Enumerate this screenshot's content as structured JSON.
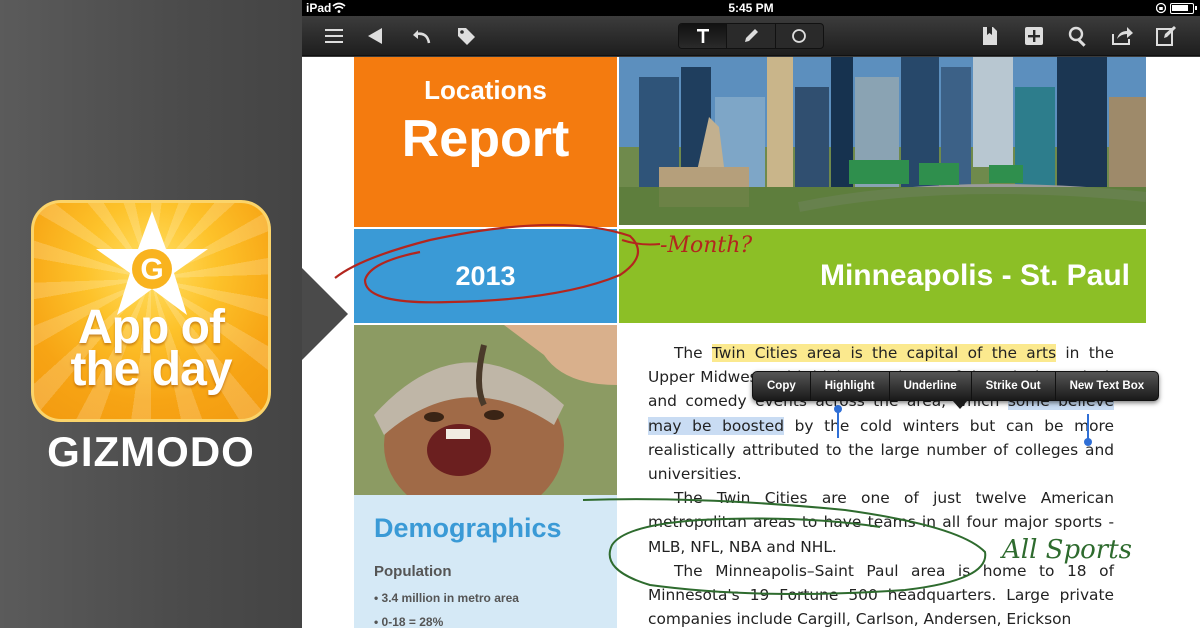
{
  "promo": {
    "badge_letter": "G",
    "badge_title_line1": "App of",
    "badge_title_line2": "the day",
    "brand": "GIZMODO"
  },
  "statusbar": {
    "carrier": "iPad",
    "time": "5:45 PM"
  },
  "toolbar": {
    "left_icons": [
      "menu-icon",
      "back-arrow-icon",
      "undo-icon",
      "tag-icon"
    ],
    "modes": [
      "text-tool-icon",
      "pen-tool-icon",
      "shape-tool-icon"
    ],
    "active_mode": "text-tool-icon",
    "right_icons": [
      "bookmark-icon",
      "add-page-icon",
      "search-icon",
      "share-icon",
      "compose-icon"
    ]
  },
  "document": {
    "title_small": "Locations",
    "title_big": "Report",
    "year": "2013",
    "city": "Minneapolis - St. Paul",
    "demographics_title": "Demographics",
    "population_label": "Population",
    "population_items": [
      "• 3.4 million in metro area",
      "• 0-18 = 28%"
    ],
    "para1_pre": "The ",
    "para1_highlight": "Twin Cities area is the capital of the arts",
    "para1_mid": " in the Upper Midwest, with high attendance of theatrical, musical, and comedy events across the area, which ",
    "para1_selected": "some believe may be boosted",
    "para1_post": " by the cold winters but can be more realistically attributed to the large number of colleges and universities.",
    "para2": "The Twin Cities are one of just twelve American metropolitan areas to have teams in all four major sports - MLB, NFL, NBA and NHL.",
    "para3": "The Minneapolis–Saint Paul area is home to 18 of Minnesota's 19 Fortune 500 headquarters. Large private companies include Cargill, Carlson, Andersen, Erickson"
  },
  "context_menu": [
    "Copy",
    "Highlight",
    "Underline",
    "Strike Out",
    "New Text Box"
  ],
  "annotations": {
    "note_month": "-Month?",
    "note_sports": "All Sports",
    "red_ink": "#b3261e",
    "green_ink": "#2e6b2e"
  }
}
